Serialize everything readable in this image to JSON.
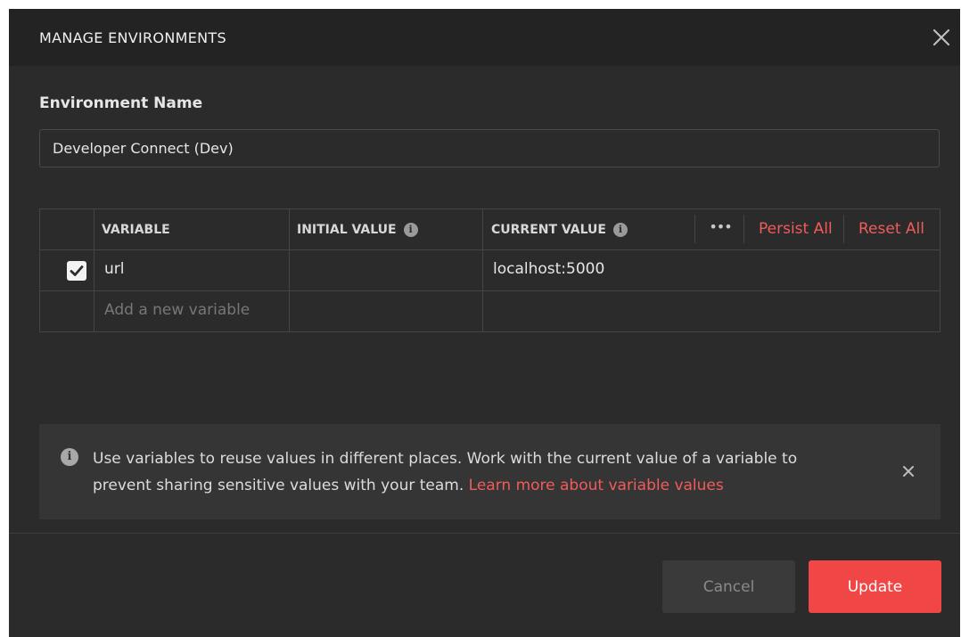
{
  "dialog": {
    "title": "MANAGE ENVIRONMENTS",
    "close_icon": "close-icon"
  },
  "environment": {
    "label": "Environment Name",
    "name_value": "Developer Connect (Dev)"
  },
  "table": {
    "headers": {
      "variable": "VARIABLE",
      "initial_value": "INITIAL VALUE",
      "current_value": "CURRENT VALUE",
      "more_icon": "more-horizontal-icon",
      "persist_all": "Persist All",
      "reset_all": "Reset All"
    },
    "rows": [
      {
        "enabled": true,
        "variable": "url",
        "initial_value": "",
        "current_value": "localhost:5000"
      }
    ],
    "new_row_placeholder": "Add a new variable"
  },
  "info_banner": {
    "icon": "info-icon",
    "text": "Use variables to reuse values in different places. Work with the current value of a variable to prevent sharing sensitive values with your team.",
    "link_text": "Learn more about variable values",
    "close_icon": "close-icon"
  },
  "footer": {
    "cancel_label": "Cancel",
    "update_label": "Update"
  },
  "colors": {
    "background": "#2b2b2b",
    "header": "#232323",
    "accent": "#f14646",
    "link": "#f15b5b"
  }
}
